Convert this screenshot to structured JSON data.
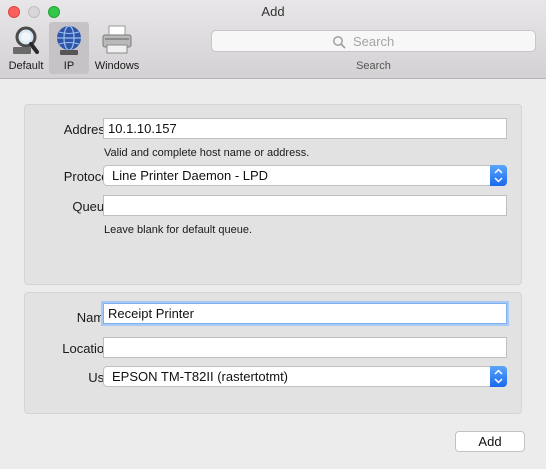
{
  "window": {
    "title": "Add"
  },
  "toolbar": {
    "items": [
      {
        "label": "Default",
        "icon": "magnifier-icon"
      },
      {
        "label": "IP",
        "icon": "globe-icon",
        "selected": true
      },
      {
        "label": "Windows",
        "icon": "printer-icon"
      }
    ],
    "search": {
      "placeholder": "Search",
      "caption": "Search"
    }
  },
  "form": {
    "address": {
      "label": "Address:",
      "value": "10.1.10.157",
      "hint": "Valid and complete host name or address."
    },
    "protocol": {
      "label": "Protocol:",
      "value": "Line Printer Daemon - LPD"
    },
    "queue": {
      "label": "Queue:",
      "value": "",
      "hint": "Leave blank for default queue."
    },
    "name": {
      "label": "Name:",
      "value": "Receipt Printer"
    },
    "location": {
      "label": "Location:",
      "value": ""
    },
    "use": {
      "label": "Use:",
      "value": "EPSON TM-T82II (rastertotmt)"
    }
  },
  "buttons": {
    "add": "Add"
  },
  "colors": {
    "accent": "#1d6ef0",
    "focus_ring": "#a8c9f4"
  }
}
